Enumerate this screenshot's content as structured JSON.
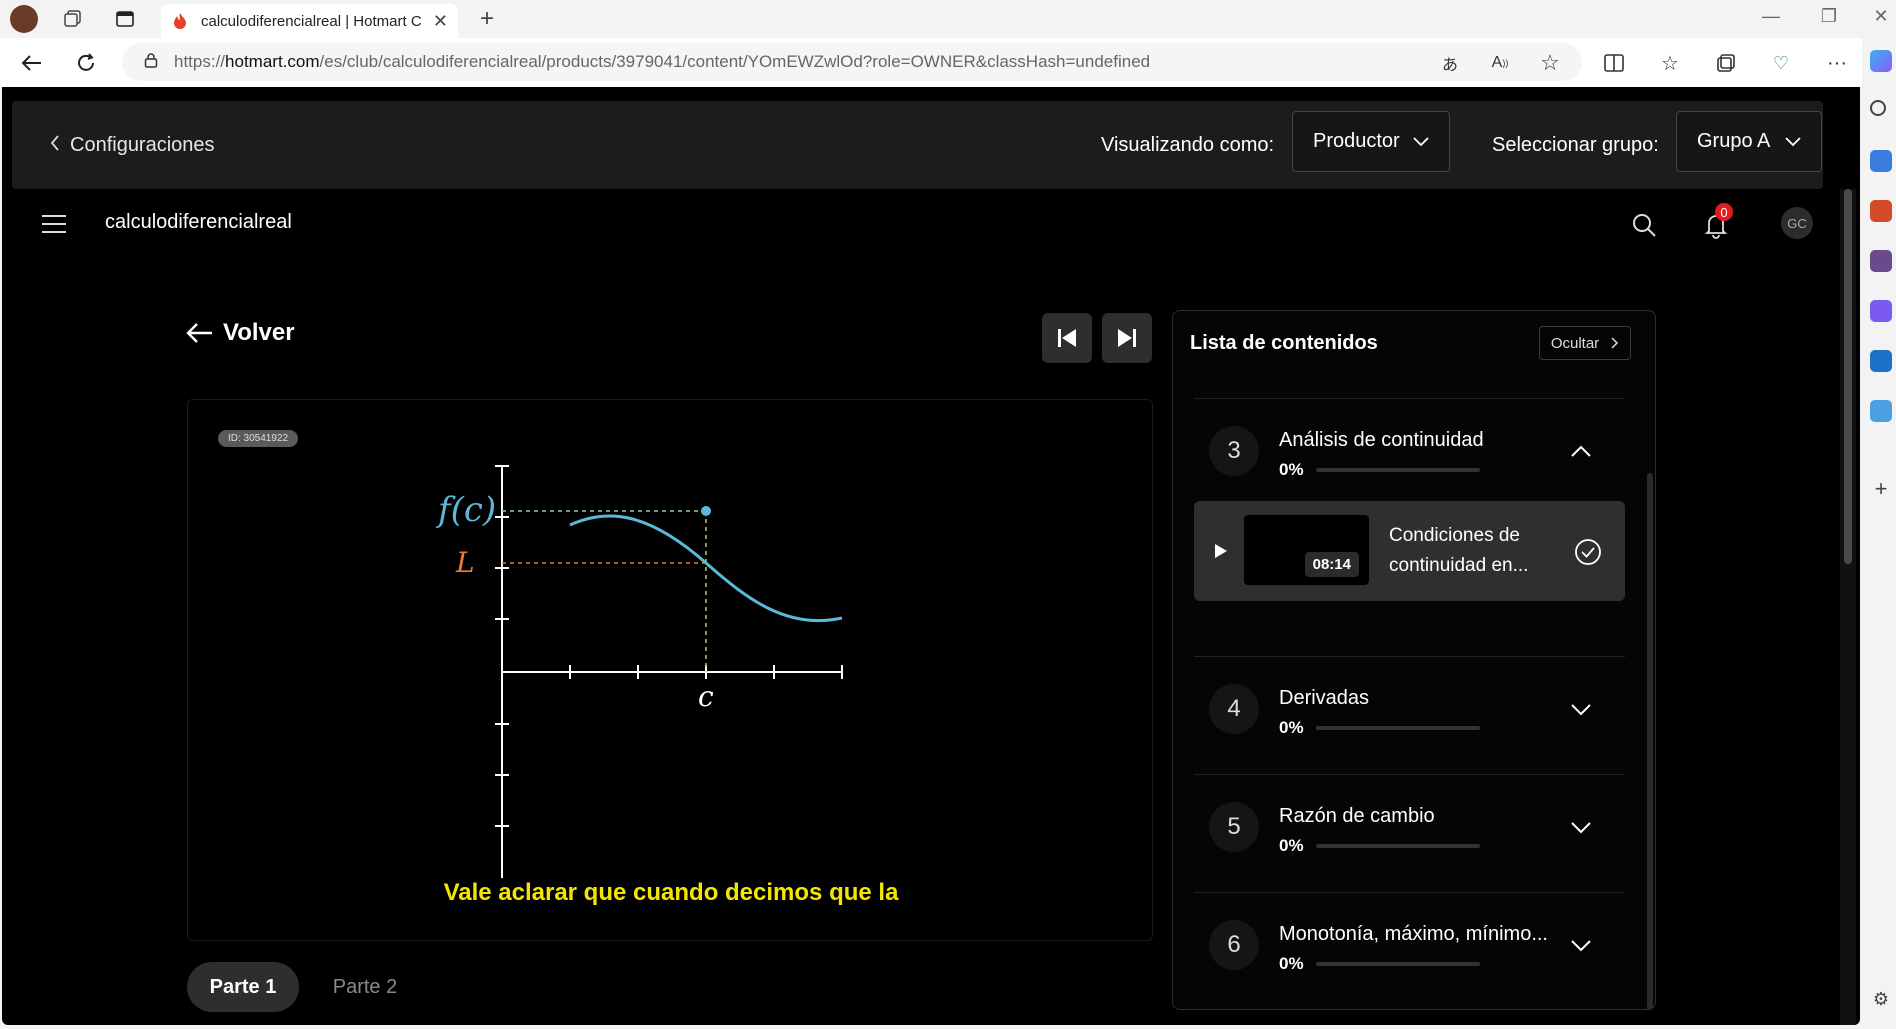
{
  "browser": {
    "tab_title": "calculodiferencialreal | Hotmart C",
    "url_prefix": "https://",
    "url_host": "hotmart.com",
    "url_path": "/es/club/calculodiferencialreal/products/3979041/content/YOmEWZwlOd?role=OWNER&classHash=undefined"
  },
  "admin_bar": {
    "back_label": "Configuraciones",
    "viewing_as_label": "Visualizando como:",
    "viewing_as_value": "Productor",
    "group_label": "Seleccionar grupo:",
    "group_value": "Grupo A"
  },
  "header": {
    "brand": "calculodiferencialreal",
    "notifications": "0",
    "avatar_initials": "GC"
  },
  "player": {
    "back_label": "Volver",
    "video_id": "ID: 30541922",
    "subtitle": "Vale aclarar que cuando decimos que la",
    "graph": {
      "y_label_top": "f(c)",
      "y_label_bottom": "L",
      "x_label": "c"
    },
    "parts": [
      "Parte 1",
      "Parte 2"
    ]
  },
  "content_list": {
    "title": "Lista de contenidos",
    "hide_label": "Ocultar",
    "modules": [
      {
        "number": "3",
        "title": "Análisis de continuidad",
        "progress_label": "0%",
        "progress": 0,
        "expanded": true
      },
      {
        "number": "4",
        "title": "Derivadas",
        "progress_label": "0%",
        "progress": 0,
        "expanded": false
      },
      {
        "number": "5",
        "title": "Razón de cambio",
        "progress_label": "0%",
        "progress": 0,
        "expanded": false
      },
      {
        "number": "6",
        "title": "Monotonía, máximo, mínimo...",
        "progress_label": "0%",
        "progress": 0,
        "expanded": false
      }
    ],
    "lesson": {
      "title": "Condiciones de continuidad en...",
      "duration": "08:14"
    }
  },
  "colors": {
    "accent_blue": "#5bb8d8",
    "orange": "#e87d32",
    "subtitle_yellow": "#f5e600",
    "badge_red": "#e01e1e"
  }
}
